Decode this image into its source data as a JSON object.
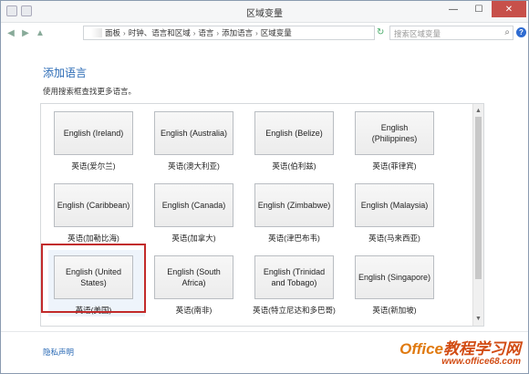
{
  "window": {
    "title": "区域变量"
  },
  "addressbar": {
    "crumbs": [
      "面板",
      "时钟、语言和区域",
      "语言",
      "添加语言",
      "区域变量"
    ],
    "search_placeholder": "搜索区域变量"
  },
  "content": {
    "heading": "添加语言",
    "subtext": "使用搜索框查找更多语言。"
  },
  "languages": [
    {
      "tile": "English (Ireland)",
      "caption": "英语(爱尔兰)"
    },
    {
      "tile": "English (Australia)",
      "caption": "英语(澳大利亚)"
    },
    {
      "tile": "English (Belize)",
      "caption": "英语(伯利兹)"
    },
    {
      "tile": "English (Philippines)",
      "caption": "英语(菲律宾)"
    },
    {
      "tile": "English (Caribbean)",
      "caption": "英语(加勒比海)"
    },
    {
      "tile": "English (Canada)",
      "caption": "英语(加拿大)"
    },
    {
      "tile": "English (Zimbabwe)",
      "caption": "英语(津巴布韦)"
    },
    {
      "tile": "English (Malaysia)",
      "caption": "英语(马来西亚)"
    },
    {
      "tile": "English (United States)",
      "caption": "英语(美国)",
      "selected": true
    },
    {
      "tile": "English (South Africa)",
      "caption": "英语(南非)"
    },
    {
      "tile": "English (Trinidad and Tobago)",
      "caption": "英语(特立尼达和多巴哥)"
    },
    {
      "tile": "English (Singapore)",
      "caption": "英语(新加坡)"
    }
  ],
  "footer": {
    "privacy": "隐私声明",
    "watermark_brand": "Office",
    "watermark_cn": "教程学习网",
    "watermark_url": "www.office68.com"
  },
  "colors": {
    "accent": "#2a6ab5",
    "selection": "#c22a2a",
    "watermark": "#e07a10"
  }
}
